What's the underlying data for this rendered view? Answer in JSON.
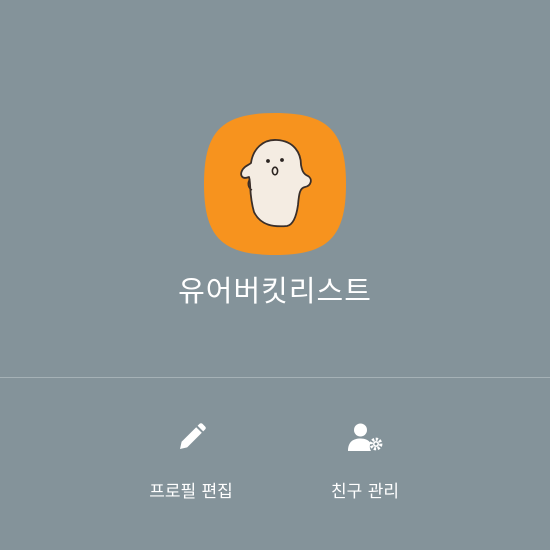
{
  "profile": {
    "name": "유어버킷리스트"
  },
  "actions": {
    "edit_profile_label": "프로필 편집",
    "manage_friends_label": "친구 관리"
  },
  "icons": {
    "avatar": "ghost-avatar",
    "edit": "pencil-icon",
    "friends": "user-gear-icon"
  },
  "colors": {
    "background": "#84939a",
    "avatar_background": "#f7931e",
    "text": "#ffffff"
  }
}
